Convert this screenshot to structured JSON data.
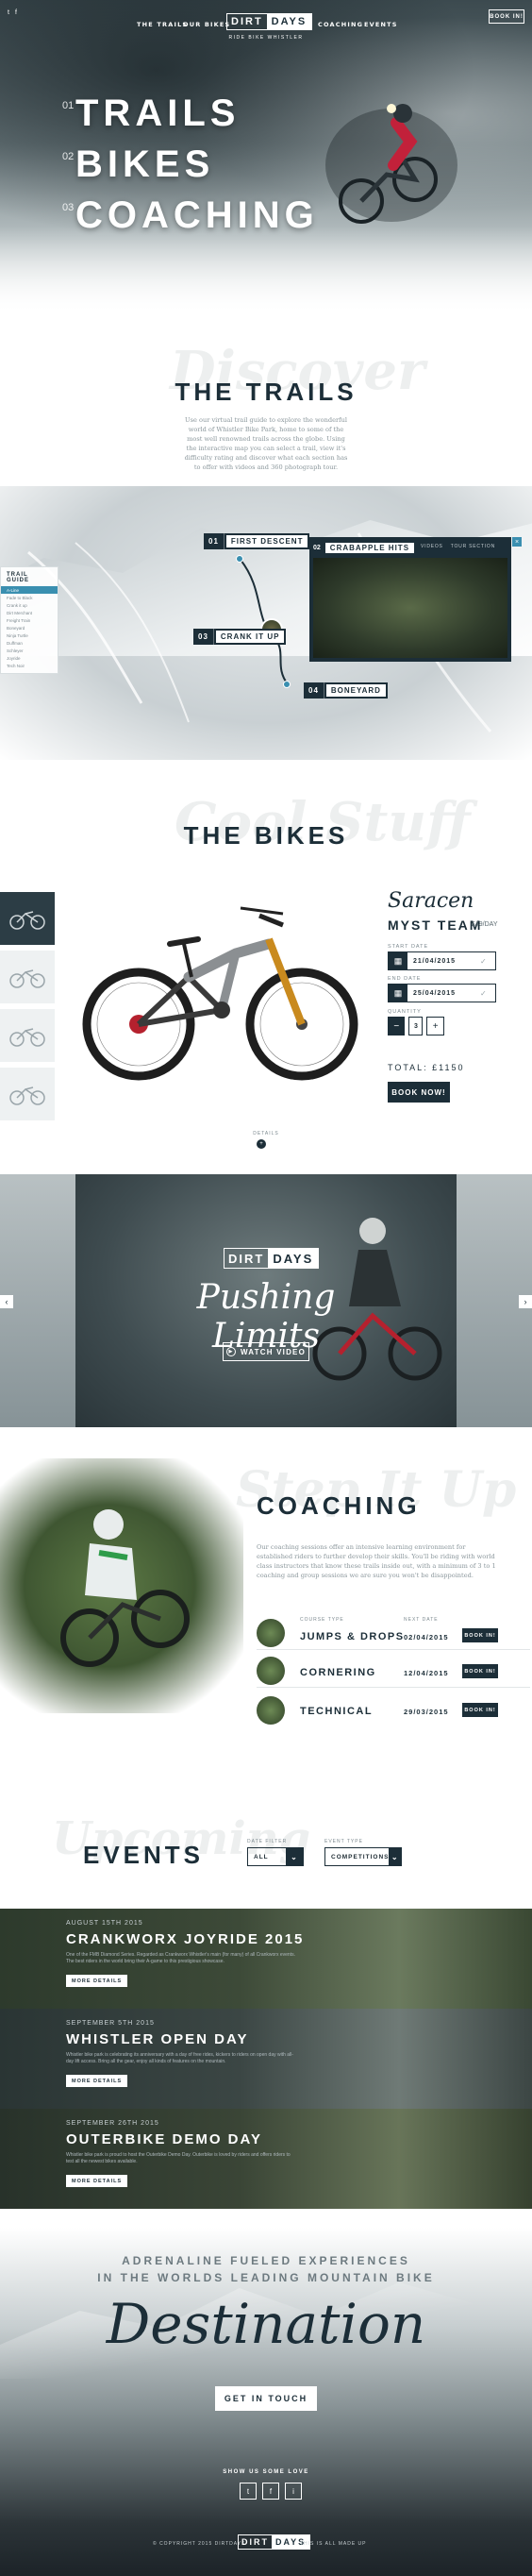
{
  "nav": {
    "left_links": [
      "The Trails",
      "Our Bikes"
    ],
    "right_links": [
      "Coaching",
      "Events"
    ],
    "logo_a": "DIRT",
    "logo_b": "DAYS",
    "tagline": "Ride Bike Whistler",
    "book_label": "Book In!",
    "social": [
      "t",
      "f"
    ]
  },
  "hero": {
    "items": [
      {
        "num": "01",
        "word": "TRAILS"
      },
      {
        "num": "02",
        "word": "BIKES"
      },
      {
        "num": "03",
        "word": "COACHING"
      }
    ]
  },
  "trails": {
    "ghost": "Discover",
    "title": "THE TRAILS",
    "body": "Use our virtual trail guide to explore the wonderful world of Whistler Bike Park, home to some of the most well renowned trails across the globe. Using the interactive map you can select a trail, view it's difficulty rating and discover what each section has to offer with videos and 360 photograph tour.",
    "markers": [
      {
        "num": "01",
        "name": "FIRST DESCENT"
      },
      {
        "num": "03",
        "name": "CRANK IT UP"
      },
      {
        "num": "04",
        "name": "BONEYARD"
      }
    ],
    "popup": {
      "num": "02",
      "name": "CRABAPPLE HITS",
      "video": "Videos",
      "tour": "Tour Section"
    },
    "guide_title": "TRAIL GUIDE",
    "guide_items": [
      "A-Line",
      "Fade to Black",
      "Crank it up",
      "Dirt Merchant",
      "Freight Train",
      "Boneyard",
      "Ninja Turtle",
      "Duffman",
      "Schleyer",
      "Joyride",
      "Tech Noir"
    ]
  },
  "bikes": {
    "ghost": "Cool Stuff",
    "title": "THE BIKES",
    "brand_script": "Saracen",
    "model": "MYST TEAM",
    "price": "£49/DAY",
    "start_label": "START DATE",
    "start_date": "21/04/2015",
    "end_label": "END DATE",
    "end_date": "25/04/2015",
    "qty_label": "QUANTITY",
    "qty": "3",
    "total": "TOTAL: £1150",
    "book": "BOOK NOW!",
    "details": "DETAILS"
  },
  "video": {
    "logo_a": "DIRT",
    "logo_b": "DAYS",
    "script": "Pushing Limits",
    "watch": "WATCH VIDEO"
  },
  "coaching": {
    "ghost": "Step It Up",
    "title": "COACHING",
    "body": "Our coaching sessions offer an intensive learning environment for established riders to further develop their skills. You'll be riding with world class instructors that know these trails inside out, with a minimum of 3 to 1 coaching and group sessions we are sure you won't be disappointed.",
    "course_label": "COURSE TYPE",
    "next_label": "NEXT DATE",
    "rows": [
      {
        "title": "JUMPS & DROPS",
        "date": "02/04/2015",
        "btn": "BOOK IN!"
      },
      {
        "title": "CORNERING",
        "date": "12/04/2015",
        "btn": "BOOK IN!"
      },
      {
        "title": "TECHNICAL",
        "date": "29/03/2015",
        "btn": "BOOK IN!"
      }
    ]
  },
  "events": {
    "ghost": "Upcoming",
    "title": "EVENTS",
    "date_filter_label": "DATE FILTER",
    "date_filter_value": "ALL",
    "event_type_label": "EVENT TYPE",
    "event_type_value": "COMPETITIONS",
    "items": [
      {
        "date": "AUGUST 15TH 2015",
        "title": "CRANKWORX JOYRIDE 2015",
        "desc": "One of the FMB Diamond Series. Regarded as Crankworx Whistler's main (for many) of all Crankworx events. The best riders in the world bring their A-game to this prestigious showcase.",
        "btn": "MORE DETAILS"
      },
      {
        "date": "SEPTEMBER 5TH 2015",
        "title": "WHISTLER OPEN DAY",
        "desc": "Whistler bike park is celebrating its anniversary with a day of free rides, kickers to riders on open day with all-day lift access. Bring all the gear, enjoy all kinds of features on the mountain.",
        "btn": "MORE DETAILS"
      },
      {
        "date": "SEPTEMBER 26TH 2015",
        "title": "OUTERBIKE DEMO DAY",
        "desc": "Whistler bike park is proud to host the Outerbike Demo Day. Outerbike is loved by riders and offers riders to test all the newest bikes available.",
        "btn": "MORE DETAILS"
      }
    ]
  },
  "footer": {
    "line1": "ADRENALINE FUELED EXPERIENCES",
    "line2": "IN THE WORLDS LEADING MOUNTAIN BIKE",
    "script": "Destination",
    "cta": "GET IN TOUCH",
    "love": "SHOW US SOME LOVE",
    "social": [
      "t",
      "f",
      "i"
    ],
    "copyright": "© COPYRIGHT 2015 DIRTDAYS",
    "logo_a": "DIRT",
    "logo_b": "DAYS",
    "made": "THIS IS ALL MADE UP"
  }
}
